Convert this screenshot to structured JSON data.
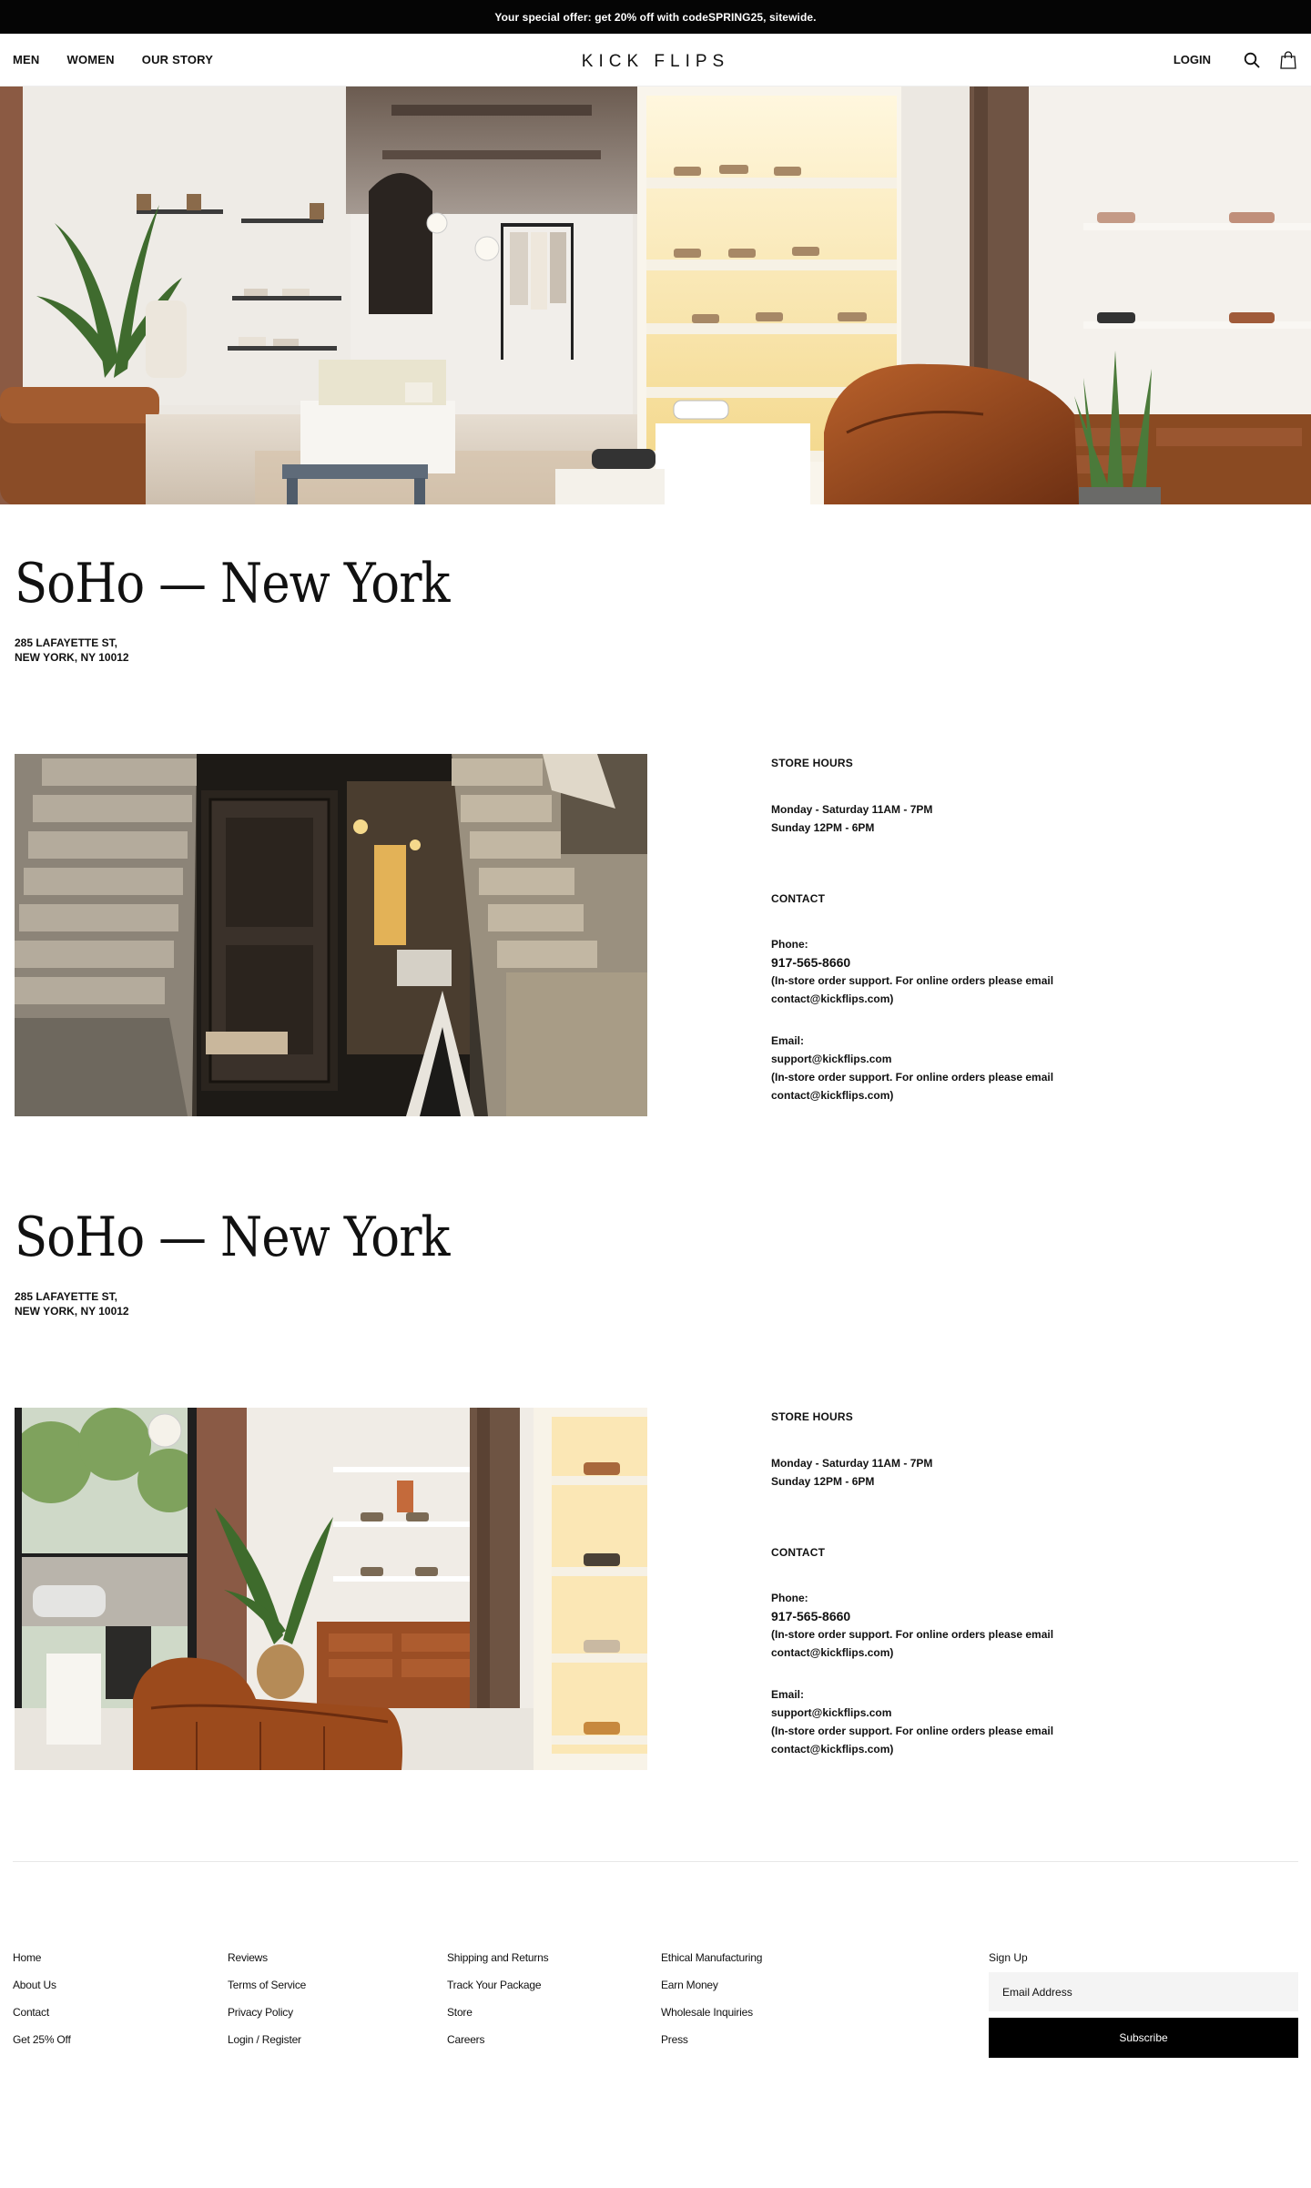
{
  "promo": {
    "prefix": "Your special offer: get 20% off with code ",
    "code": "SPRING25",
    "suffix": ", sitewide."
  },
  "header": {
    "nav": [
      "MEN",
      "WOMEN",
      "OUR STORY"
    ],
    "logo": "KICK FLIPS",
    "login": "LOGIN",
    "icons": [
      "search-icon",
      "shopping-bag-icon"
    ]
  },
  "stores": [
    {
      "title": "SoHo — New York",
      "address_line1": "285 LAFAYETTE ST,",
      "address_line2": "NEW YORK, NY 10012",
      "hours_heading": "STORE HOURS",
      "hours_line1": "Monday - Saturday 11AM - 7PM",
      "hours_line2": "Sunday 12PM - 6PM",
      "contact_heading": "CONTACT",
      "phone_label": "Phone:",
      "phone": "917-565-8660",
      "phone_note": "(In-store order support. For online orders please email contact@kickflips.com)",
      "email_label": "Email:",
      "email": "support@kickflips.com",
      "email_note": "(In-store order support. For online orders please email contact@kickflips.com)"
    },
    {
      "title": "SoHo — New York",
      "address_line1": "285 LAFAYETTE ST,",
      "address_line2": "NEW YORK, NY 10012",
      "hours_heading": "STORE HOURS",
      "hours_line1": "Monday - Saturday 11AM - 7PM",
      "hours_line2": "Sunday 12PM - 6PM",
      "contact_heading": "CONTACT",
      "phone_label": "Phone:",
      "phone": "917-565-8660",
      "phone_note": "(In-store order support. For online orders please email contact@kickflips.com)",
      "email_label": "Email:",
      "email": "support@kickflips.com",
      "email_note": "(In-store order support. For online orders please email contact@kickflips.com)"
    }
  ],
  "footer": {
    "col1": [
      "Home",
      "About Us",
      "Contact",
      "Get 25% Off"
    ],
    "col2": [
      "Reviews",
      "Terms of Service",
      "Privacy Policy",
      "Login / Register"
    ],
    "col3": [
      "Shipping and Returns",
      "Track Your Package",
      "Store",
      "Careers"
    ],
    "col4": [
      "Ethical Manufacturing",
      "Earn Money",
      "Wholesale Inquiries",
      "Press"
    ],
    "signup_label": "Sign Up",
    "email_placeholder": "Email Address",
    "subscribe": "Subscribe"
  },
  "colors": {
    "promo_bg": "#050505",
    "button_bg": "#000000",
    "input_bg": "#f4f4f4",
    "wood": "#8a4a22",
    "leather": "#9c4a1c",
    "shelf_glow": "#fff1c8"
  }
}
